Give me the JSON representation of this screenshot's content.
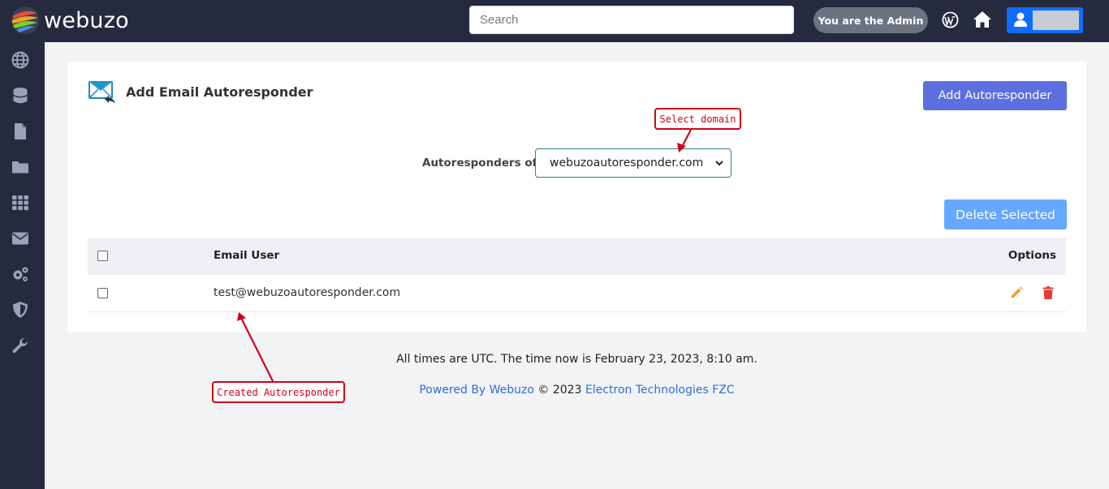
{
  "header": {
    "brand": "webuzo",
    "search_placeholder": "Search",
    "admin_label": "You are the Admin",
    "icons": [
      "wordpress-icon",
      "home-icon",
      "user-icon"
    ]
  },
  "sidebar": {
    "items": [
      {
        "icon": "globe-icon"
      },
      {
        "icon": "database-icon"
      },
      {
        "icon": "file-icon"
      },
      {
        "icon": "folder-icon"
      },
      {
        "icon": "apps-grid-icon"
      },
      {
        "icon": "envelope-icon"
      },
      {
        "icon": "gears-icon"
      },
      {
        "icon": "shield-icon"
      },
      {
        "icon": "wrench-icon"
      }
    ]
  },
  "main": {
    "title": "Add Email Autoresponder",
    "add_button": "Add Autoresponder",
    "domain_label": "Autoresponders of",
    "domain_selected": "webuzoautoresponder.com",
    "delete_button": "Delete Selected",
    "table": {
      "columns": [
        "Email User",
        "Options"
      ],
      "rows": [
        {
          "email_user": "test@webuzoautoresponder.com"
        }
      ]
    }
  },
  "footer": {
    "time_text": "All times are UTC. The time now is February 23, 2023, 8:10 am.",
    "powered_link": "Powered By Webuzo",
    "copyright": "© 2023",
    "company_link": "Electron Technologies FZC"
  },
  "annotations": {
    "select_domain": "Select domain",
    "created_autoresponder": "Created Autoresponder"
  },
  "colors": {
    "nav_bg": "#252a3e",
    "primary_button": "#5c6fe0",
    "delete_button": "#66a8ff",
    "edit_icon": "#f0a020",
    "trash_icon": "#e53935",
    "annotation": "#d0021b",
    "link": "#2f6fd6"
  }
}
